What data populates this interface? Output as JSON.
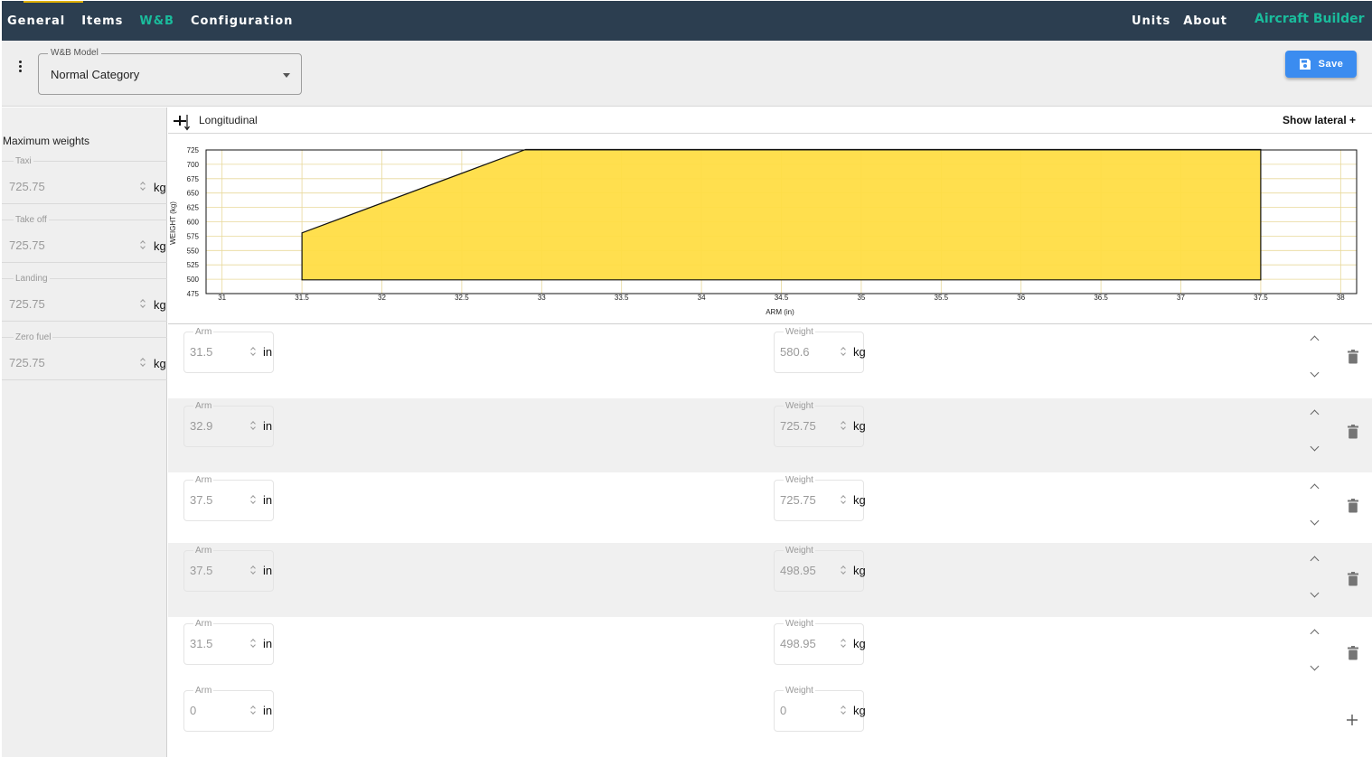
{
  "nav": {
    "items": [
      {
        "label": "General",
        "active": false
      },
      {
        "label": "Items",
        "active": false
      },
      {
        "label": "W&B",
        "active": true
      },
      {
        "label": "Configuration",
        "active": false
      }
    ],
    "right_items": [
      {
        "label": "Units"
      },
      {
        "label": "About"
      }
    ],
    "brand": "Aircraft Builder"
  },
  "toolbar": {
    "model_label": "W&B Model",
    "model_value": "Normal Category",
    "save_label": "Save"
  },
  "sidebar": {
    "title": "Maximum weights",
    "fields": [
      {
        "label": "Taxi",
        "value": "725.75",
        "unit": "kg"
      },
      {
        "label": "Take off",
        "value": "725.75",
        "unit": "kg"
      },
      {
        "label": "Landing",
        "value": "725.75",
        "unit": "kg"
      },
      {
        "label": "Zero fuel",
        "value": "725.75",
        "unit": "kg"
      }
    ]
  },
  "chart_header": {
    "title": "Longitudinal",
    "show_lateral": "Show lateral +"
  },
  "chart_data": {
    "type": "area",
    "xlabel": "ARM (in)",
    "ylabel": "WEIGHT (kg)",
    "xlim": [
      30.9,
      38.1
    ],
    "ylim": [
      475,
      725
    ],
    "x_ticks": [
      "31",
      "31.5",
      "32",
      "32.5",
      "33",
      "33.5",
      "34",
      "34.5",
      "35",
      "35.5",
      "36",
      "36.5",
      "37",
      "37.5",
      "38"
    ],
    "y_ticks": [
      "725",
      "700",
      "675",
      "650",
      "625",
      "600",
      "575",
      "550",
      "525",
      "500",
      "475"
    ],
    "grid": true,
    "fill_color": "#ffdd44",
    "grid_color": "#e8d89a",
    "polygon": [
      {
        "x": 31.5,
        "y": 580.6
      },
      {
        "x": 32.9,
        "y": 725.75
      },
      {
        "x": 37.5,
        "y": 725.75
      },
      {
        "x": 37.5,
        "y": 498.95
      },
      {
        "x": 31.5,
        "y": 498.95
      }
    ]
  },
  "points": [
    {
      "arm_label": "Arm",
      "arm": "31.5",
      "arm_unit": "in",
      "weight_label": "Weight",
      "weight": "580.6",
      "weight_unit": "kg"
    },
    {
      "arm_label": "Arm",
      "arm": "32.9",
      "arm_unit": "in",
      "weight_label": "Weight",
      "weight": "725.75",
      "weight_unit": "kg"
    },
    {
      "arm_label": "Arm",
      "arm": "37.5",
      "arm_unit": "in",
      "weight_label": "Weight",
      "weight": "725.75",
      "weight_unit": "kg"
    },
    {
      "arm_label": "Arm",
      "arm": "37.5",
      "arm_unit": "in",
      "weight_label": "Weight",
      "weight": "498.95",
      "weight_unit": "kg"
    },
    {
      "arm_label": "Arm",
      "arm": "31.5",
      "arm_unit": "in",
      "weight_label": "Weight",
      "weight": "498.95",
      "weight_unit": "kg"
    }
  ],
  "new_point": {
    "arm_label": "Arm",
    "arm": "0",
    "arm_unit": "in",
    "weight_label": "Weight",
    "weight": "0",
    "weight_unit": "kg"
  },
  "colors": {
    "nav_bg": "#2c3e50",
    "accent": "#1abc9c",
    "save": "#3b8cf0"
  }
}
